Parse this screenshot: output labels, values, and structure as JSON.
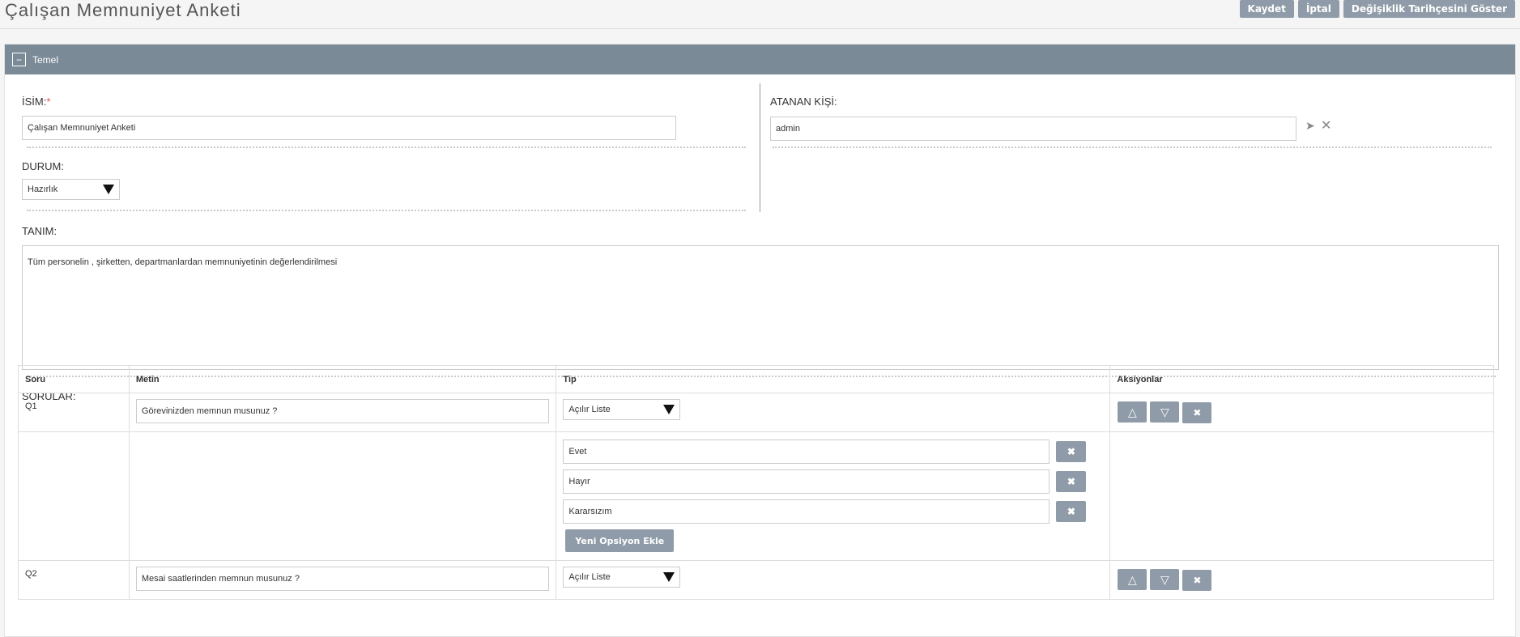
{
  "page": {
    "title": "Çalışan Memnuniyet Anketi",
    "actions": {
      "save": "Kaydet",
      "cancel": "İptal",
      "history": "Değişiklik Tarihçesini Göster"
    }
  },
  "panel": {
    "toggle_symbol": "−",
    "title": "Temel"
  },
  "form": {
    "name_label": "İSİM:",
    "name_required_mark": "*",
    "name_value": "Çalışan Memnuniyet Anketi",
    "assigned_label": "ATANAN KİŞİ:",
    "assigned_value": "admin",
    "status_label": "DURUM:",
    "status_value": "Hazırlık",
    "description_label": "TANIM:",
    "description_value": "Tüm personelin , şirketten, departmanlardan memnuniyetinin değerlendirilmesi"
  },
  "icons": {
    "select_icon": "pointer-arrow",
    "clear_icon": "close-x"
  },
  "questions": {
    "label": "SORULAR:",
    "headers": {
      "soru": "Soru",
      "metin": "Metin",
      "tip": "Tip",
      "aksiyonlar": "Aksiyonlar"
    },
    "rows": [
      {
        "id": "Q1",
        "text": "Görevinizden memnun musunuz ?",
        "type": "Açılır Liste",
        "options": [
          "Evet",
          "Hayır",
          "Kararsızım"
        ],
        "add_option_label": "Yeni Opsiyon Ekle"
      },
      {
        "id": "Q2",
        "text": "Mesai saatlerinden memnun musunuz ?",
        "type": "Açılır Liste"
      }
    ],
    "action_symbols": {
      "up": "△",
      "down": "▽",
      "remove": "✖"
    }
  },
  "colors": {
    "panel_header": "#7a8a97",
    "button": "#8f9ba8",
    "required": "#d9534f"
  }
}
